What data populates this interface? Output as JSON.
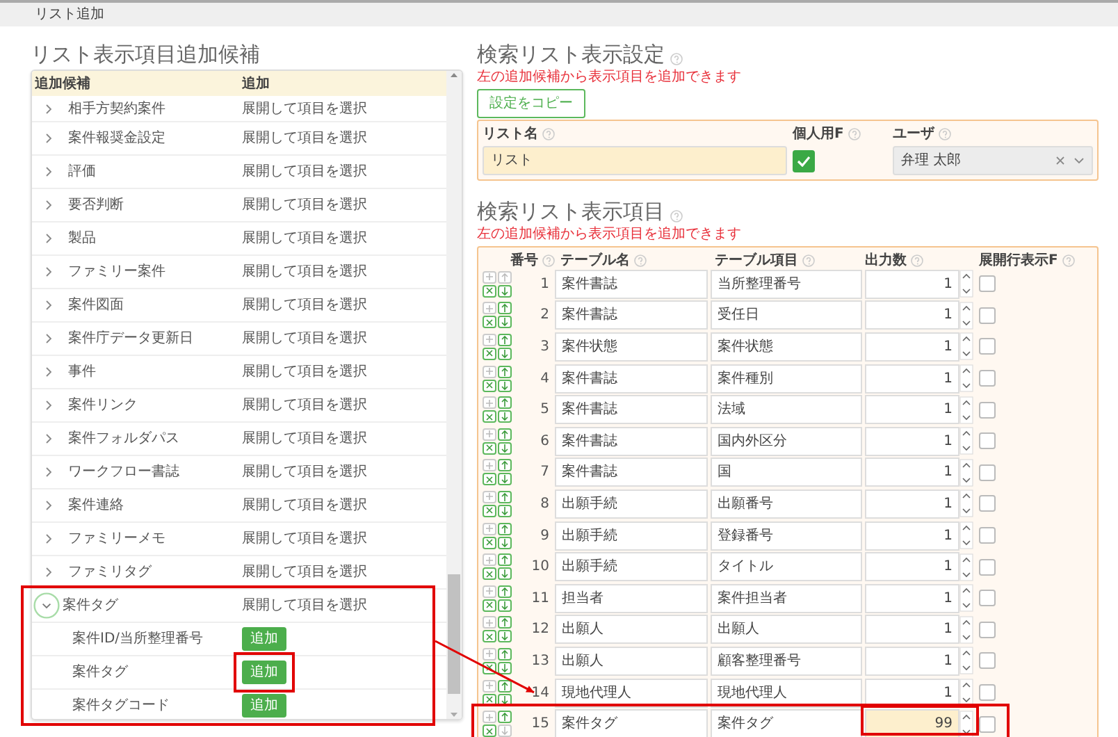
{
  "page_title": "リスト追加",
  "candidates": {
    "title": "リスト表示項目追加候補",
    "columns": [
      "追加候補",
      "追加"
    ],
    "items": [
      {
        "label": "相手方契約案件",
        "action": "展開して項目を選択",
        "expanded": false
      },
      {
        "label": "案件報奨金設定",
        "action": "展開して項目を選択",
        "expanded": false
      },
      {
        "label": "評価",
        "action": "展開して項目を選択",
        "expanded": false
      },
      {
        "label": "要否判断",
        "action": "展開して項目を選択",
        "expanded": false
      },
      {
        "label": "製品",
        "action": "展開して項目を選択",
        "expanded": false
      },
      {
        "label": "ファミリー案件",
        "action": "展開して項目を選択",
        "expanded": false
      },
      {
        "label": "案件図面",
        "action": "展開して項目を選択",
        "expanded": false
      },
      {
        "label": "案件庁データ更新日",
        "action": "展開して項目を選択",
        "expanded": false
      },
      {
        "label": "事件",
        "action": "展開して項目を選択",
        "expanded": false
      },
      {
        "label": "案件リンク",
        "action": "展開して項目を選択",
        "expanded": false
      },
      {
        "label": "案件フォルダパス",
        "action": "展開して項目を選択",
        "expanded": false
      },
      {
        "label": "ワークフロー書誌",
        "action": "展開して項目を選択",
        "expanded": false
      },
      {
        "label": "案件連絡",
        "action": "展開して項目を選択",
        "expanded": false
      },
      {
        "label": "ファミリーメモ",
        "action": "展開して項目を選択",
        "expanded": false
      },
      {
        "label": "ファミリタグ",
        "action": "展開して項目を選択",
        "expanded": false
      },
      {
        "label": "案件タグ",
        "action": "展開して項目を選択",
        "expanded": true,
        "highlighted": true,
        "children": [
          {
            "label": "案件ID/当所整理番号",
            "button": "追加",
            "highlighted": false
          },
          {
            "label": "案件タグ",
            "button": "追加",
            "highlighted": true
          },
          {
            "label": "案件タグコード",
            "button": "追加",
            "highlighted": false
          }
        ]
      }
    ]
  },
  "settings": {
    "title": "検索リスト表示設定",
    "note": "左の追加候補から表示項目を追加できます",
    "copy_button": "設定をコピー",
    "list_name": {
      "label": "リスト名",
      "value": "リスト"
    },
    "personal": {
      "label": "個人用F",
      "checked": true
    },
    "user": {
      "label": "ユーザ",
      "value": "弁理 太郎"
    }
  },
  "items": {
    "title": "検索リスト表示項目",
    "note": "左の追加候補から表示項目を追加できます",
    "columns": [
      "番号",
      "テーブル名",
      "テーブル項目",
      "出力数",
      "展開行表示F"
    ],
    "rows": [
      {
        "no": "1",
        "table": "案件書誌",
        "field": "当所整理番号",
        "count": "1",
        "expand": false,
        "up_disabled": true,
        "down_disabled": false,
        "highlighted": false,
        "count_highlighted": false
      },
      {
        "no": "2",
        "table": "案件書誌",
        "field": "受任日",
        "count": "1",
        "expand": false,
        "up_disabled": false,
        "down_disabled": false,
        "highlighted": false,
        "count_highlighted": false
      },
      {
        "no": "3",
        "table": "案件状態",
        "field": "案件状態",
        "count": "1",
        "expand": false,
        "up_disabled": false,
        "down_disabled": false,
        "highlighted": false,
        "count_highlighted": false
      },
      {
        "no": "4",
        "table": "案件書誌",
        "field": "案件種別",
        "count": "1",
        "expand": false,
        "up_disabled": false,
        "down_disabled": false,
        "highlighted": false,
        "count_highlighted": false
      },
      {
        "no": "5",
        "table": "案件書誌",
        "field": "法域",
        "count": "1",
        "expand": false,
        "up_disabled": false,
        "down_disabled": false,
        "highlighted": false,
        "count_highlighted": false
      },
      {
        "no": "6",
        "table": "案件書誌",
        "field": "国内外区分",
        "count": "1",
        "expand": false,
        "up_disabled": false,
        "down_disabled": false,
        "highlighted": false,
        "count_highlighted": false
      },
      {
        "no": "7",
        "table": "案件書誌",
        "field": "国",
        "count": "1",
        "expand": false,
        "up_disabled": false,
        "down_disabled": false,
        "highlighted": false,
        "count_highlighted": false
      },
      {
        "no": "8",
        "table": "出願手続",
        "field": "出願番号",
        "count": "1",
        "expand": false,
        "up_disabled": false,
        "down_disabled": false,
        "highlighted": false,
        "count_highlighted": false
      },
      {
        "no": "9",
        "table": "出願手続",
        "field": "登録番号",
        "count": "1",
        "expand": false,
        "up_disabled": false,
        "down_disabled": false,
        "highlighted": false,
        "count_highlighted": false
      },
      {
        "no": "10",
        "table": "出願手続",
        "field": "タイトル",
        "count": "1",
        "expand": false,
        "up_disabled": false,
        "down_disabled": false,
        "highlighted": false,
        "count_highlighted": false
      },
      {
        "no": "11",
        "table": "担当者",
        "field": "案件担当者",
        "count": "1",
        "expand": false,
        "up_disabled": false,
        "down_disabled": false,
        "highlighted": false,
        "count_highlighted": false
      },
      {
        "no": "12",
        "table": "出願人",
        "field": "出願人",
        "count": "1",
        "expand": false,
        "up_disabled": false,
        "down_disabled": false,
        "highlighted": false,
        "count_highlighted": false
      },
      {
        "no": "13",
        "table": "出願人",
        "field": "顧客整理番号",
        "count": "1",
        "expand": false,
        "up_disabled": false,
        "down_disabled": false,
        "highlighted": false,
        "count_highlighted": false
      },
      {
        "no": "14",
        "table": "現地代理人",
        "field": "現地代理人",
        "count": "1",
        "expand": false,
        "up_disabled": false,
        "down_disabled": false,
        "highlighted": false,
        "count_highlighted": false
      },
      {
        "no": "15",
        "table": "案件タグ",
        "field": "案件タグ",
        "count": "99",
        "expand": false,
        "up_disabled": false,
        "down_disabled": true,
        "highlighted": true,
        "count_highlighted": true
      }
    ]
  },
  "annotation_arrow": true
}
